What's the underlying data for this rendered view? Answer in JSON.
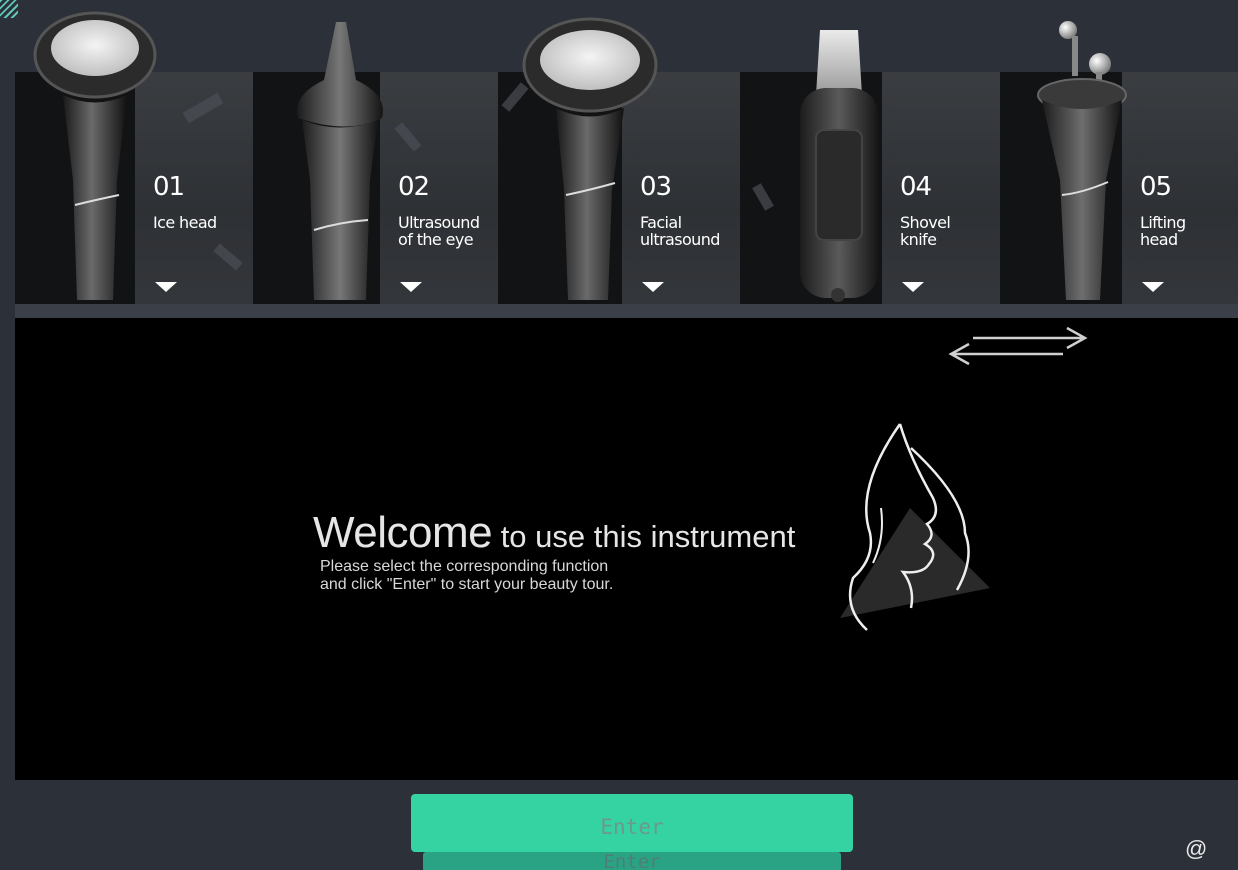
{
  "tool_cards": [
    {
      "number": "01",
      "label": "Ice head",
      "icon": "ice-head-icon"
    },
    {
      "number": "02",
      "label": "Ultrasound\nof the eye",
      "icon": "eye-ultrasound-icon"
    },
    {
      "number": "03",
      "label": "Facial\nultrasound",
      "icon": "facial-ultrasound-icon"
    },
    {
      "number": "04",
      "label": "Shovel\nknife",
      "icon": "shovel-knife-icon"
    },
    {
      "number": "05",
      "label": "Lifting\nhead",
      "icon": "lifting-head-icon"
    }
  ],
  "welcome": {
    "title_big": "Welcome",
    "title_rest": " to use this instrument",
    "subtitle": "Please select the corresponding function\nand click \"Enter\" to start your beauty tour."
  },
  "enter_button": {
    "label": "Enter",
    "shadow_label": "Enter"
  },
  "footer": {
    "at_symbol": "@"
  },
  "colors": {
    "background": "#2c3038",
    "accent": "#34d3a1",
    "main_panel": "#000000"
  }
}
